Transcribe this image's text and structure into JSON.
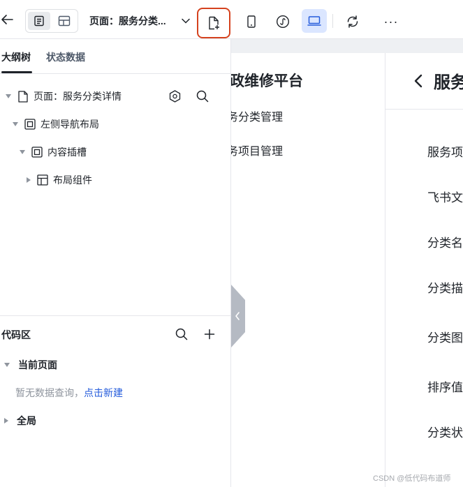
{
  "toolbar": {
    "page_title": "页面：服务分类...",
    "more_label": "···"
  },
  "left_panel": {
    "tabs": [
      {
        "label": "大纲树"
      },
      {
        "label": "状态数据"
      }
    ],
    "tree": [
      {
        "label": "页面：服务分类详情",
        "icon": "page-icon"
      },
      {
        "label": "左侧导航布局",
        "icon": "box-icon"
      },
      {
        "label": "内容插槽",
        "icon": "box-icon"
      },
      {
        "label": "布局组件",
        "icon": "layout-icon"
      }
    ],
    "code_area": {
      "title": "代码区",
      "current_page": "当前页面",
      "empty_text": "暂无数据查询，",
      "create_link": "点击新建",
      "global": "全局"
    }
  },
  "canvas": {
    "brand": "政维修平台",
    "nav": [
      "务分类管理",
      "务项目管理"
    ],
    "page_heading": "服务",
    "fields": [
      "服务项",
      "飞书文",
      "分类名",
      "分类描",
      "分类图",
      "排序值",
      "分类状"
    ]
  },
  "watermark": "CSDN @低代码布道师",
  "colors": {
    "accent": "#245bdb",
    "highlight_border": "#d5421e",
    "active_device_bg": "#dbe6ff"
  }
}
